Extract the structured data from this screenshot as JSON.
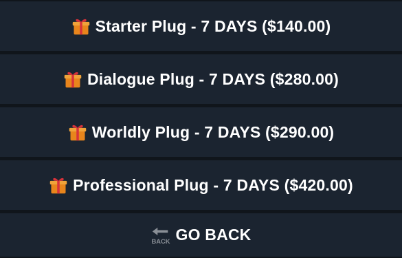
{
  "menu": {
    "items": [
      {
        "icon": "gift-icon",
        "label": "Starter Plug - 7 DAYS ($140.00)"
      },
      {
        "icon": "gift-icon",
        "label": "Dialogue Plug - 7 DAYS ($280.00)"
      },
      {
        "icon": "gift-icon",
        "label": "Worldly Plug - 7 DAYS ($290.00)"
      },
      {
        "icon": "gift-icon",
        "label": "Professional Plug - 7 DAYS ($420.00)"
      }
    ],
    "back": {
      "icon": "back-arrow-icon",
      "icon_text": "BACK",
      "label": "GO BACK"
    }
  },
  "colors": {
    "background": "#10151b",
    "button": "#1b2430",
    "text": "#ffffff",
    "gift_box": "#e8851c",
    "gift_ribbon": "#d8323a"
  }
}
